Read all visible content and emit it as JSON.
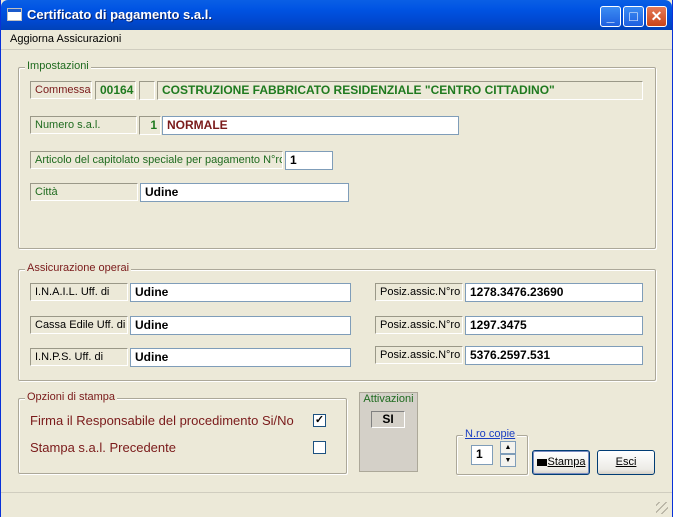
{
  "window": {
    "title": "Certificato di pagamento s.a.l."
  },
  "menu": {
    "item": "Aggiorna Assicurazioni"
  },
  "impostazioni": {
    "legend": "Impostazioni",
    "commessa_label": "Commessa",
    "commessa_code": "00164",
    "commessa_desc": "COSTRUZIONE FABBRICATO RESIDENZIALE \"CENTRO CITTADINO\"",
    "numero_label": "Numero s.a.l.",
    "numero_value": "1",
    "numero_desc": "NORMALE",
    "articolo_label": "Articolo del capitolato speciale per pagamento N°ro",
    "articolo_value": "1",
    "citta_label": "Città",
    "citta_value": "Udine"
  },
  "assicurazione": {
    "legend": "Assicurazione operai",
    "rows": [
      {
        "label": "I.N.A.I.L.   Uff. di",
        "uff": "Udine",
        "posiz_label": "Posiz.assic.N°ro",
        "posiz": "1278.3476.23690"
      },
      {
        "label": "Cassa Edile Uff. di",
        "uff": "Udine",
        "posiz_label": "Posiz.assic.N°ro",
        "posiz": "1297.3475"
      },
      {
        "label": "I.N.P.S.     Uff. di",
        "uff": "Udine",
        "posiz_label": "Posiz.assic.N°ro",
        "posiz": "5376.2597.531"
      }
    ]
  },
  "opzioni": {
    "legend": "Opzioni di stampa",
    "firma_label": "Firma il Responsabile del procedimento Si/No",
    "firma_mark": "✓",
    "precedente_label": "Stampa s.a.l. Precedente",
    "precedente_mark": ""
  },
  "attivazioni": {
    "legend": "Attivazioni",
    "value": "SI"
  },
  "copie": {
    "legend": "N.ro copie",
    "value": "1"
  },
  "buttons": {
    "stampa": "Stampa",
    "esci": "Esci"
  }
}
